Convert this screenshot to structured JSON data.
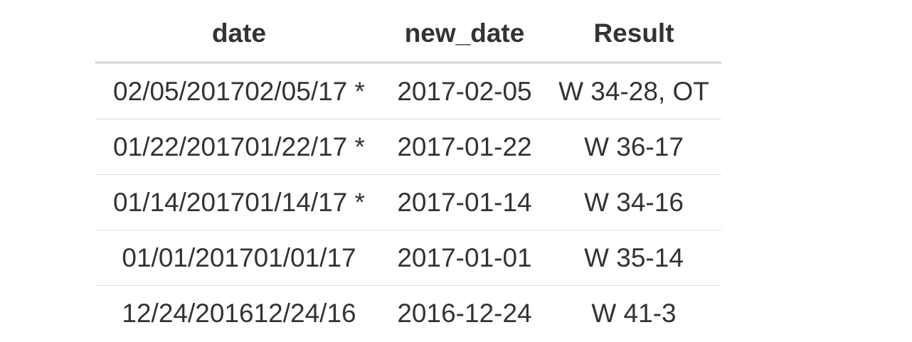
{
  "table": {
    "headers": [
      "date",
      "new_date",
      "Result"
    ],
    "rows": [
      [
        "02/05/201702/05/17 *",
        "2017-02-05",
        "W 34-28, OT"
      ],
      [
        "01/22/201701/22/17 *",
        "2017-01-22",
        "W 36-17"
      ],
      [
        "01/14/201701/14/17 *",
        "2017-01-14",
        "W 34-16"
      ],
      [
        "01/01/201701/01/17",
        "2017-01-01",
        "W 35-14"
      ],
      [
        "12/24/201612/24/16",
        "2016-12-24",
        "W 41-3"
      ]
    ]
  }
}
